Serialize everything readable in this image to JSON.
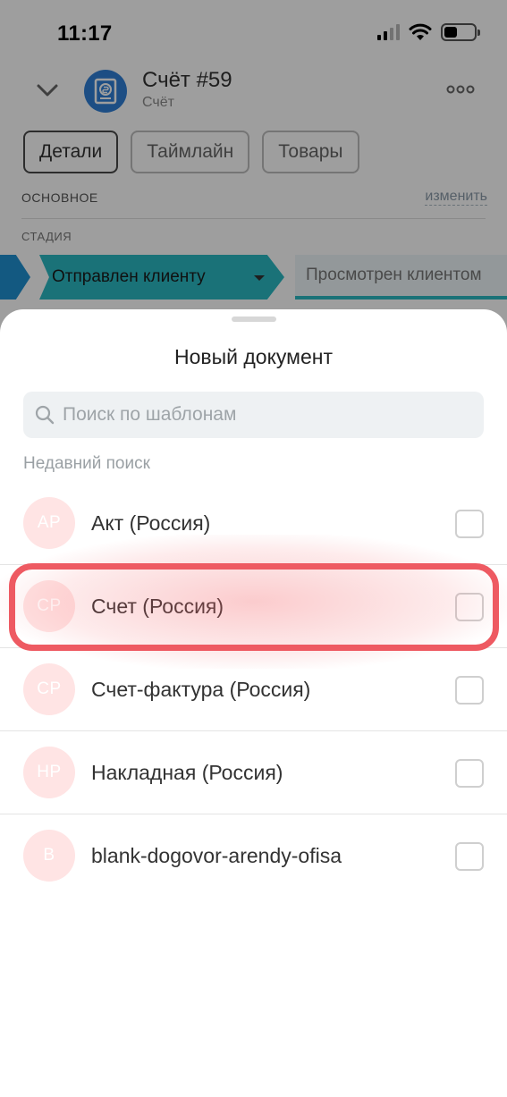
{
  "status_bar": {
    "time": "11:17"
  },
  "header": {
    "title": "Счёт #59",
    "subtitle": "Счёт"
  },
  "tabs": [
    {
      "label": "Детали",
      "active": true
    },
    {
      "label": "Таймлайн",
      "active": false
    },
    {
      "label": "Товары",
      "active": false
    }
  ],
  "details": {
    "section_title": "ОСНОВНОЕ",
    "edit_label": "изменить",
    "stage_label": "СТАДИЯ"
  },
  "stages": {
    "current": "Отправлен клиенту",
    "next": "Просмотрен клиентом"
  },
  "sheet": {
    "title": "Новый документ",
    "search_placeholder": "Поиск по шаблонам",
    "recent_label": "Недавний поиск",
    "items": [
      {
        "initials": "АР",
        "label": "Акт (Россия)"
      },
      {
        "initials": "СР",
        "label": "Счет (Россия)"
      },
      {
        "initials": "СР",
        "label": "Счет-фактура (Россия)"
      },
      {
        "initials": "НР",
        "label": "Накладная (Россия)"
      },
      {
        "initials": "B",
        "label": "blank-dogovor-arendy-ofisa"
      }
    ]
  },
  "colors": {
    "accent_blue": "#2f7fd6",
    "stage_teal": "#2ab8c2",
    "highlight_red": "#ee5a62",
    "avatar_pink": "#ffe4e4"
  },
  "icons": [
    "chevron-down-icon",
    "invoice-icon",
    "more-icon",
    "search-icon",
    "signal-icon",
    "wifi-icon",
    "battery-icon"
  ]
}
